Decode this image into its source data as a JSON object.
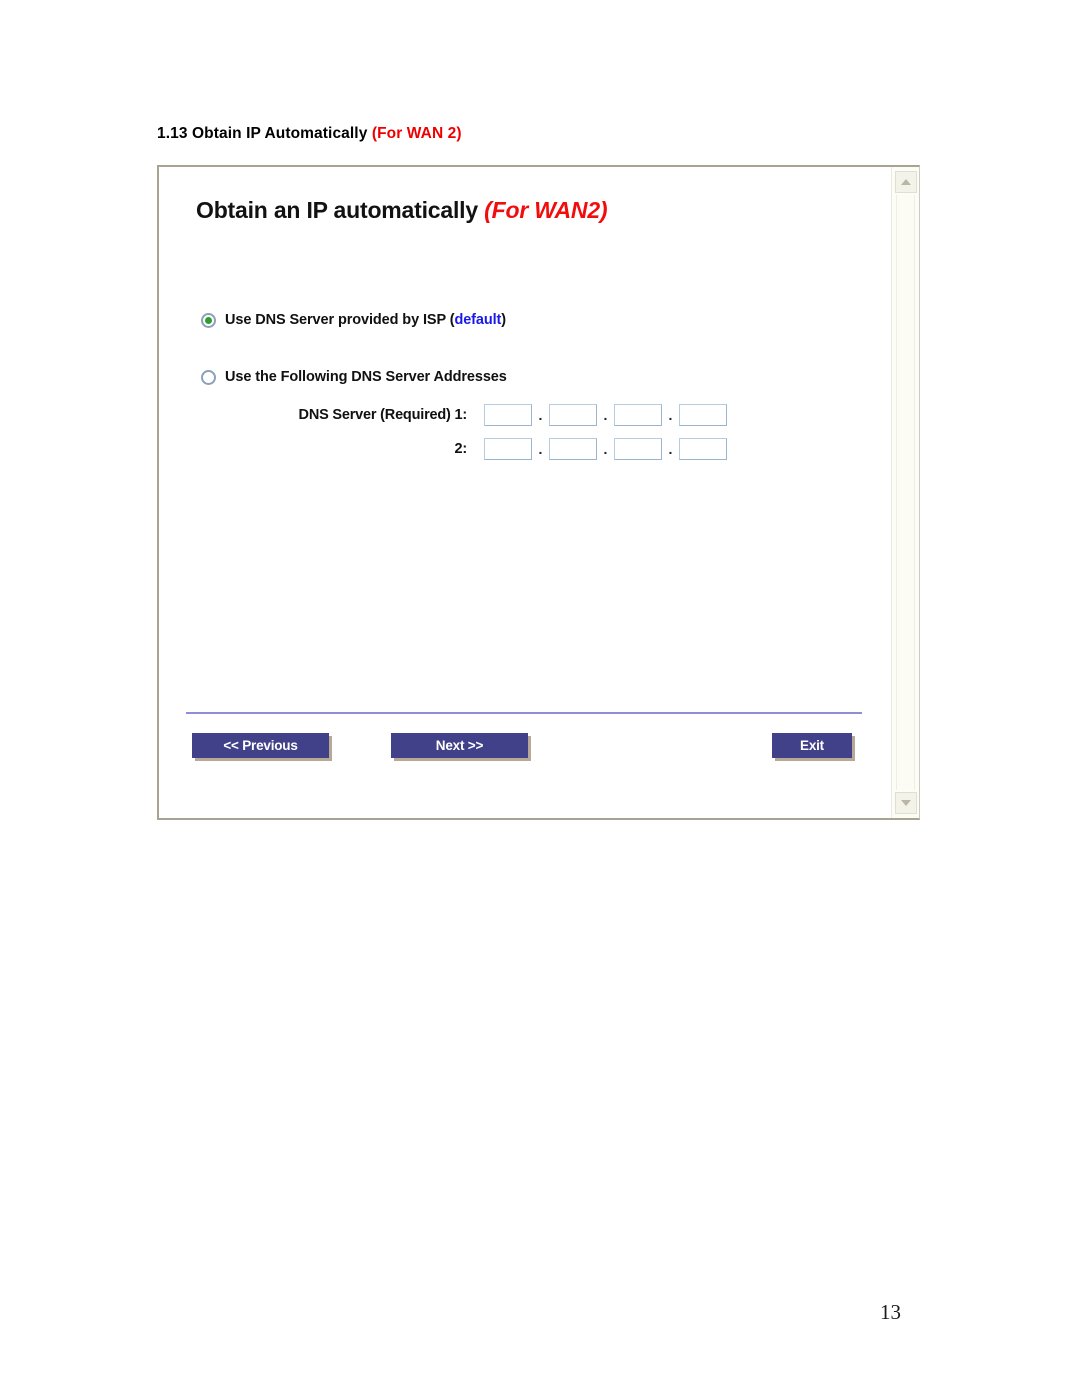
{
  "document": {
    "heading_number": "1.13",
    "heading_black": "Obtain IP Automatically",
    "heading_red": "(For WAN 2)",
    "page_number": "13"
  },
  "dialog": {
    "title_black": "Obtain an IP automatically",
    "title_red": "(For WAN2)",
    "colors": {
      "title_red": "#f20d0d",
      "link_blue": "#1a1ae8",
      "button_bg": "#414189",
      "divider": "#8e8ed6",
      "radio_dot": "#2e9e2e",
      "frame_border": "#a9a391",
      "input_border": "#9bb5cf"
    },
    "options": [
      {
        "id": "isp-dns",
        "label_plain": "Use DNS Server provided by ISP (",
        "label_highlight": "default",
        "label_tail": ")",
        "selected": true
      },
      {
        "id": "manual-dns",
        "label_plain": "Use the Following DNS Server Addresses",
        "label_highlight": "",
        "label_tail": "",
        "selected": false
      }
    ],
    "dns_fields": [
      {
        "label": "DNS Server (Required) 1:",
        "octets": [
          "",
          "",
          "",
          ""
        ],
        "separator": "."
      },
      {
        "label": "2:",
        "octets": [
          "",
          "",
          "",
          ""
        ],
        "separator": "."
      }
    ],
    "buttons": {
      "previous": "<< Previous",
      "next": "Next >>",
      "exit": "Exit"
    },
    "scrollbar": {
      "up_icon": "chevron-up-icon",
      "down_icon": "chevron-down-icon"
    }
  }
}
